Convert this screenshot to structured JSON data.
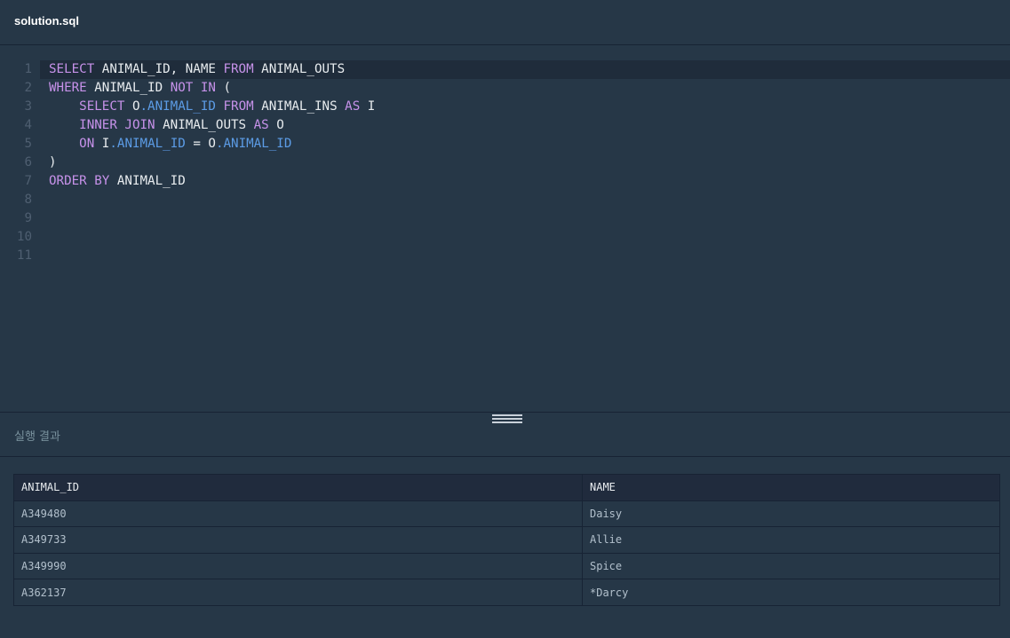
{
  "editor": {
    "file_name": "solution.sql",
    "lines": [
      {
        "num": "1",
        "tokens": [
          {
            "t": "kw",
            "v": "SELECT"
          },
          {
            "t": "plain",
            "v": " ANIMAL_ID, NAME "
          },
          {
            "t": "kw",
            "v": "FROM"
          },
          {
            "t": "plain",
            "v": " ANIMAL_OUTS"
          }
        ]
      },
      {
        "num": "2",
        "tokens": [
          {
            "t": "kw",
            "v": "WHERE"
          },
          {
            "t": "plain",
            "v": " ANIMAL_ID "
          },
          {
            "t": "kw",
            "v": "NOT IN"
          },
          {
            "t": "plain",
            "v": " ("
          }
        ]
      },
      {
        "num": "3",
        "tokens": [
          {
            "t": "plain",
            "v": "    "
          },
          {
            "t": "kw",
            "v": "SELECT"
          },
          {
            "t": "plain",
            "v": " O"
          },
          {
            "t": "col",
            "v": ".ANIMAL_ID"
          },
          {
            "t": "plain",
            "v": " "
          },
          {
            "t": "kw",
            "v": "FROM"
          },
          {
            "t": "plain",
            "v": " ANIMAL_INS "
          },
          {
            "t": "kw",
            "v": "AS"
          },
          {
            "t": "plain",
            "v": " I"
          }
        ]
      },
      {
        "num": "4",
        "tokens": [
          {
            "t": "plain",
            "v": "    "
          },
          {
            "t": "kw",
            "v": "INNER JOIN"
          },
          {
            "t": "plain",
            "v": " ANIMAL_OUTS "
          },
          {
            "t": "kw",
            "v": "AS"
          },
          {
            "t": "plain",
            "v": " O"
          }
        ]
      },
      {
        "num": "5",
        "tokens": [
          {
            "t": "plain",
            "v": "    "
          },
          {
            "t": "kw",
            "v": "ON"
          },
          {
            "t": "plain",
            "v": " I"
          },
          {
            "t": "col",
            "v": ".ANIMAL_ID"
          },
          {
            "t": "plain",
            "v": " = O"
          },
          {
            "t": "col",
            "v": ".ANIMAL_ID"
          }
        ]
      },
      {
        "num": "6",
        "tokens": [
          {
            "t": "plain",
            "v": ")"
          }
        ]
      },
      {
        "num": "7",
        "tokens": [
          {
            "t": "kw",
            "v": "ORDER BY"
          },
          {
            "t": "plain",
            "v": " ANIMAL_ID"
          }
        ]
      },
      {
        "num": "8",
        "tokens": []
      },
      {
        "num": "9",
        "tokens": []
      },
      {
        "num": "10",
        "tokens": []
      },
      {
        "num": "11",
        "tokens": []
      }
    ]
  },
  "results": {
    "title": "실행 결과",
    "columns": [
      "ANIMAL_ID",
      "NAME"
    ],
    "rows": [
      [
        "A349480",
        "Daisy"
      ],
      [
        "A349733",
        "Allie"
      ],
      [
        "A349990",
        "Spice"
      ],
      [
        "A362137",
        "*Darcy"
      ]
    ]
  },
  "colors": {
    "background": "#263747",
    "keyword": "#c792ea",
    "column_ref": "#5c9ce6",
    "text": "#e8ecef",
    "line_number": "#4f5f71"
  }
}
